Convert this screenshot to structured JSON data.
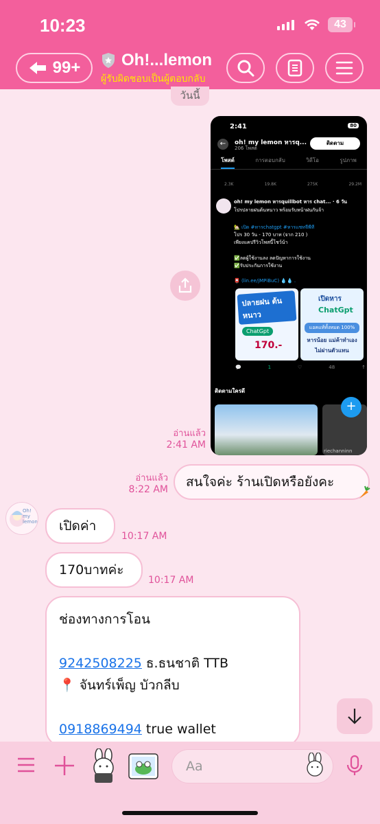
{
  "status_bar": {
    "time": "10:23",
    "battery": "43"
  },
  "header": {
    "back_count": "99+",
    "title": "Oh!...lemon",
    "subtitle": "ผู้รับผิดชอบเป็นผู้ตอบกลับ",
    "icons": [
      "search-icon",
      "notes-icon",
      "menu-icon"
    ]
  },
  "chat": {
    "date_label": "วันนี้",
    "screenshot": {
      "time": "2:41",
      "battery": "80",
      "profile_name": "oh! my lemon หารq...",
      "posts_count": "206 โพสต์",
      "follow_label": "ติดตาม",
      "tabs": [
        "โพสต์",
        "การตอบกลับ",
        "วิดีโอ",
        "รูปภาพ"
      ],
      "stats": [
        "2.3K",
        "19.8K",
        "275K",
        "29.2M"
      ],
      "author": "oh! my lemon หารquillbot หาร chat... · 6 วัน",
      "lines": [
        "โปรปลายฝนต้นหนาว พร้อมรับหน้าฝนกันจ้า",
        "🏡 เปิด #หารchatgpt #หารแชทจีพีที",
        "โปร 30 วัน - 170 บาท (จาก 210 )",
        "เพียงแคปรีวิวโพสนี้โชว์น้า",
        "✅ลดผู้ใช้งานลง ลดปัญหาการใช้งาน",
        "✅รับประกันการใช้งาน",
        "📮 (lin.ee/jMPiBuC) 💧💧 ."
      ],
      "card1_title": "ปลายฝน ต้นหนาว",
      "card1_badge": "ChatGpt",
      "card1_price": "170.-",
      "card2_title": "เปิดหาร",
      "card2_badge": "ChatGpt",
      "card2_line1": "แอคแท้ทั้งหมด 100%",
      "card2_line2": "หารน้อย แม่ค้าทำเอง",
      "card2_line3": "ไม่ผ่านตัวแทน",
      "post_stats": [
        "1",
        "48"
      ],
      "who_to_follow": "ติดตามใครดี",
      "suggest_name": "riechanninn"
    },
    "screenshot_read": "อ่านแล้ว",
    "screenshot_time": "2:41 AM",
    "outgoing": {
      "read": "อ่านแล้ว",
      "time": "8:22 AM",
      "text": "สนใจค่ะ ร้านเปิดหรือยังคะ",
      "sticker_icon": "carrot-icon"
    },
    "avatar_text": "Oh! my lemon",
    "incoming": [
      {
        "text": "เปิดค่า",
        "time": "10:17 AM"
      },
      {
        "text": "170บาทค่ะ",
        "time": "10:17 AM"
      }
    ],
    "transfer": {
      "title": "ช่องทางการโอน",
      "account_number": "9242508225",
      "bank": " ธ.ธนชาติ TTB",
      "pin": "📍",
      "name": " จันทร์เพ็ญ บัวกลีบ",
      "wallet_number": "0918869494",
      "wallet_label": " true wallet"
    }
  },
  "composer": {
    "placeholder": "Aa"
  },
  "colors": {
    "header": "#f35f9c",
    "background": "#fce6ef",
    "accent_text": "#e0529a",
    "link": "#1a73e8"
  }
}
